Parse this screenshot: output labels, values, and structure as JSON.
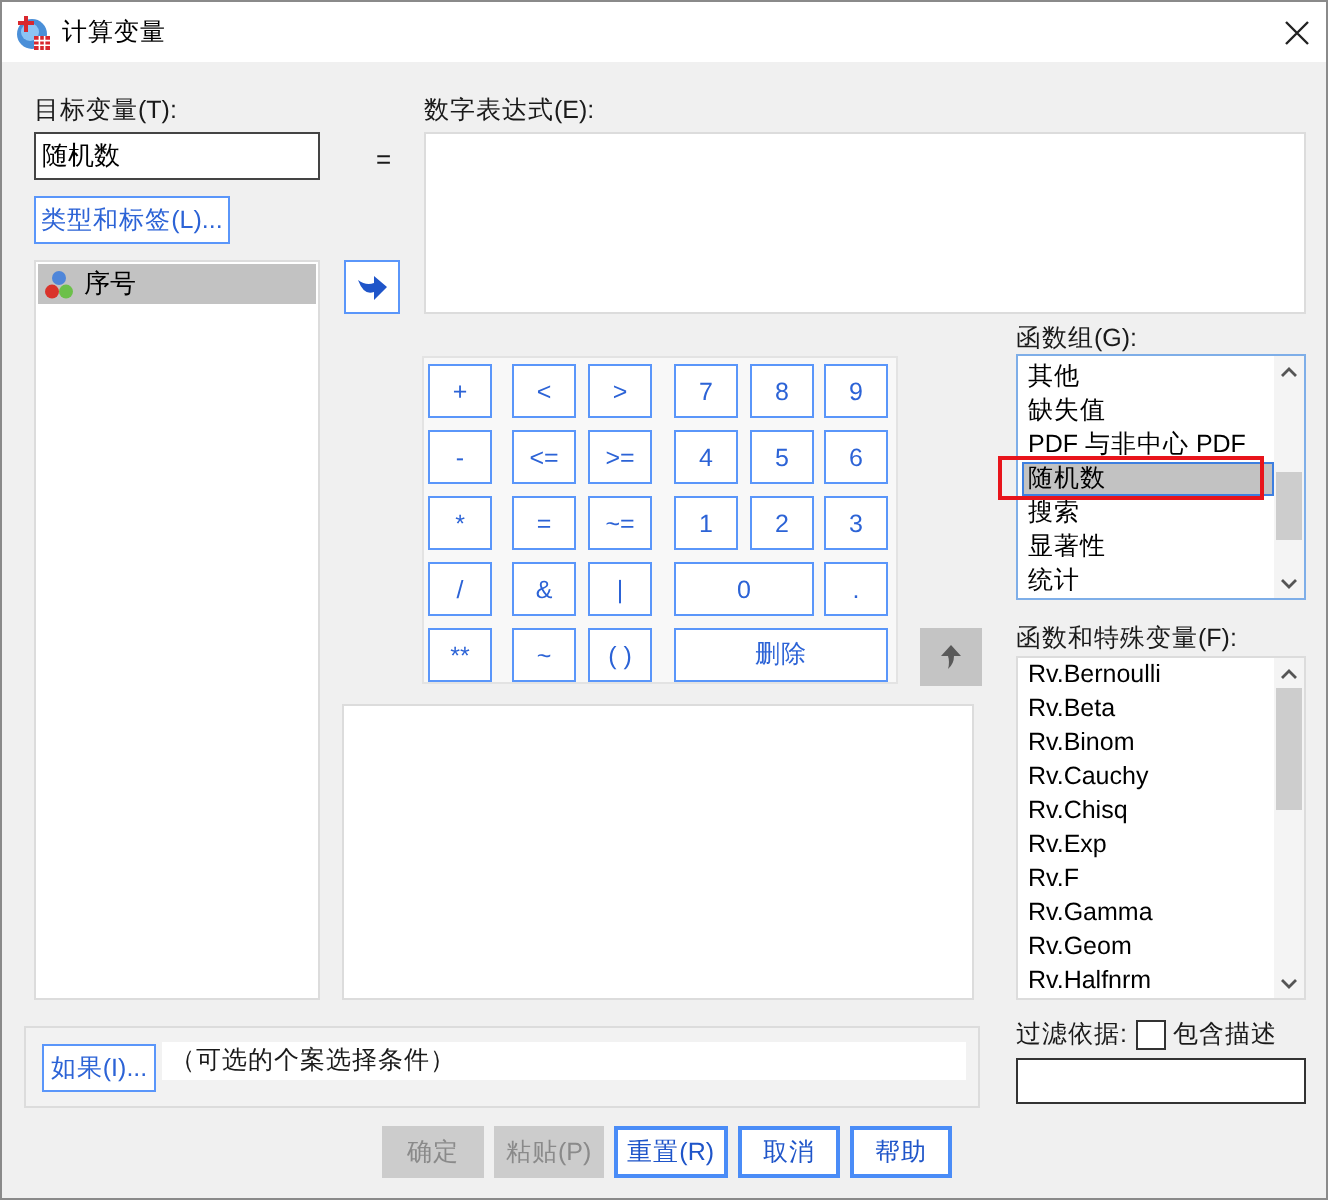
{
  "window": {
    "title": "计算变量"
  },
  "target_variable": {
    "label": "目标变量(T):",
    "value": "随机数"
  },
  "type_label_button": "类型和标签(L)...",
  "variables": [
    {
      "name": "序号",
      "selected": true
    }
  ],
  "equals": "=",
  "insert_button": {
    "disabled": false
  },
  "numeric_expression": {
    "label": "数字表达式(E):"
  },
  "keypad": [
    "+",
    "<",
    ">",
    "7",
    "8",
    "9",
    "-",
    "<=",
    ">=",
    "4",
    "5",
    "6",
    "*",
    "=",
    "~=",
    "1",
    "2",
    "3",
    "/",
    "&",
    "|",
    "0",
    ".",
    "**",
    "~",
    "( )",
    "删除"
  ],
  "move_up_button": {
    "disabled": true
  },
  "function_groups": {
    "label": "函数组(G):",
    "focused": true,
    "items": [
      {
        "name": "其他",
        "selected": false
      },
      {
        "name": "缺失值",
        "selected": false
      },
      {
        "name": "PDF 与非中心 PDF",
        "selected": false
      },
      {
        "name": "随机数",
        "selected": true
      },
      {
        "name": "搜索",
        "selected": false
      },
      {
        "name": "显著性",
        "selected": false
      },
      {
        "name": "统计",
        "selected": false
      }
    ]
  },
  "functions": {
    "label": "函数和特殊变量(F):",
    "focused": false,
    "items": [
      {
        "name": "Rv.Bernoulli",
        "selected": false
      },
      {
        "name": "Rv.Beta",
        "selected": false
      },
      {
        "name": "Rv.Binom",
        "selected": false
      },
      {
        "name": "Rv.Cauchy",
        "selected": false
      },
      {
        "name": "Rv.Chisq",
        "selected": false
      },
      {
        "name": "Rv.Exp",
        "selected": false
      },
      {
        "name": "Rv.F",
        "selected": false
      },
      {
        "name": "Rv.Gamma",
        "selected": false
      },
      {
        "name": "Rv.Geom",
        "selected": false
      },
      {
        "name": "Rv.Halfnrm",
        "selected": false
      }
    ]
  },
  "condition": {
    "button": "如果(I)...",
    "text": "（可选的个案选择条件）"
  },
  "filter": {
    "label": "过滤依据:",
    "checkbox": {
      "label": "包含描述",
      "checked": false
    }
  },
  "buttons": [
    {
      "label": "确定",
      "disabled": true
    },
    {
      "label": "粘贴(P)",
      "disabled": true
    },
    {
      "label": "重置(R)",
      "disabled": false
    },
    {
      "label": "取消",
      "disabled": false
    },
    {
      "label": "帮助",
      "disabled": false
    }
  ]
}
